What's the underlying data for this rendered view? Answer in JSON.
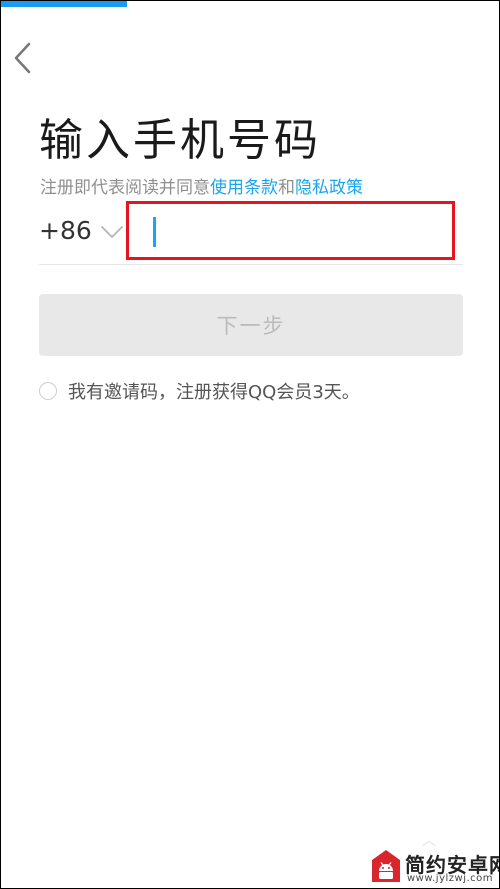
{
  "header": {
    "back_icon": "chevron-left-icon"
  },
  "page": {
    "title": "输入手机号码",
    "terms_prefix": "注册即代表阅读并同意",
    "terms_link": "使用条款",
    "terms_and": "和",
    "privacy_link": "隐私政策"
  },
  "phone": {
    "country_code": "+86",
    "dropdown_icon": "chevron-down-icon",
    "value": "",
    "placeholder": ""
  },
  "next_button": {
    "label": "下一步"
  },
  "invite": {
    "label": "我有邀请码，注册获得QQ会员3天。",
    "checked": false
  },
  "colors": {
    "accent": "#1aa5ef",
    "highlight_border": "#e6141c",
    "disabled_button_bg": "#e8e8e8",
    "disabled_button_text": "#bbbbbb"
  },
  "watermark": {
    "brand": "简约安卓网",
    "url": "www.jylzwj.com",
    "icon": "android-logo-icon"
  }
}
